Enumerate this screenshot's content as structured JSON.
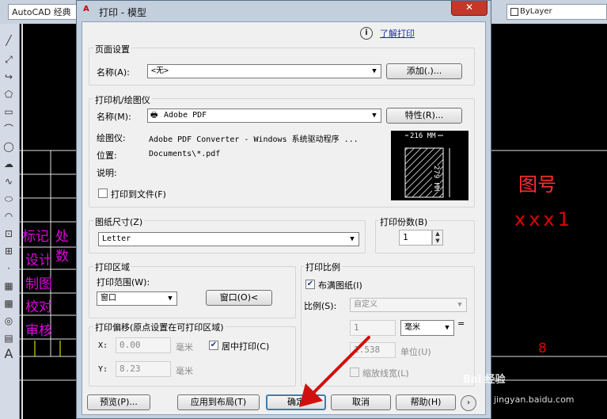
{
  "cad": {
    "title": "AutoCAD 经典",
    "bylayer": "ByLayer",
    "table_left": [
      "标记",
      "设计",
      "制图",
      "校对",
      "审核"
    ],
    "table_left_2": "处数",
    "right_label": "图号",
    "right_value": "xxx1",
    "right_number": "8"
  },
  "dialog": {
    "title": "打印 - 模型",
    "help_link": "了解打印",
    "page_setup": {
      "group": "页面设置",
      "name_label": "名称(A):",
      "name_value": "<无>",
      "add_button": "添加(.)..."
    },
    "printer": {
      "group": "打印机/绘图仪",
      "name_label": "名称(M):",
      "name_value": "Adobe PDF",
      "properties_button": "特性(R)...",
      "plotter_label": "绘图仪:",
      "plotter_value": "Adobe PDF Converter - Windows 系统驱动程序 ...",
      "location_label": "位置:",
      "location_value": "Documents\\*.pdf",
      "description_label": "说明:",
      "print_to_file": "打印到文件(F)",
      "preview_width": "216 MM",
      "preview_height": "279 MM"
    },
    "paper_size": {
      "group": "图纸尺寸(Z)",
      "value": "Letter"
    },
    "copies": {
      "group": "打印份数(B)",
      "value": "1"
    },
    "plot_area": {
      "group": "打印区域",
      "range_label": "打印范围(W):",
      "range_value": "窗口",
      "window_button": "窗口(O)<"
    },
    "plot_offset": {
      "group": "打印偏移(原点设置在可打印区域)",
      "x_label": "X:",
      "x_value": "0.00",
      "x_unit": "毫米",
      "y_label": "Y:",
      "y_value": "8.23",
      "y_unit": "毫米",
      "center": "居中打印(C)"
    },
    "plot_scale": {
      "group": "打印比例",
      "fit": "布满图纸(I)",
      "scale_label": "比例(S):",
      "scale_value": "自定义",
      "value1": "1",
      "unit": "毫米",
      "equals": "=",
      "value2": "1.538",
      "unit_label": "单位(U)",
      "lineweights": "缩放线宽(L)"
    },
    "buttons": {
      "preview": "预览(P)...",
      "apply_layout": "应用到布局(T)",
      "ok": "确定",
      "cancel": "取消",
      "help": "帮助(H)"
    }
  },
  "watermark": "Bai 经验",
  "watermark_url": "jingyan.baidu.com",
  "colors": {
    "cad_magenta": "#e000e0",
    "cad_red": "#e00000",
    "arrow_red": "#d01010",
    "default_button_border": "#3c7fb1"
  }
}
